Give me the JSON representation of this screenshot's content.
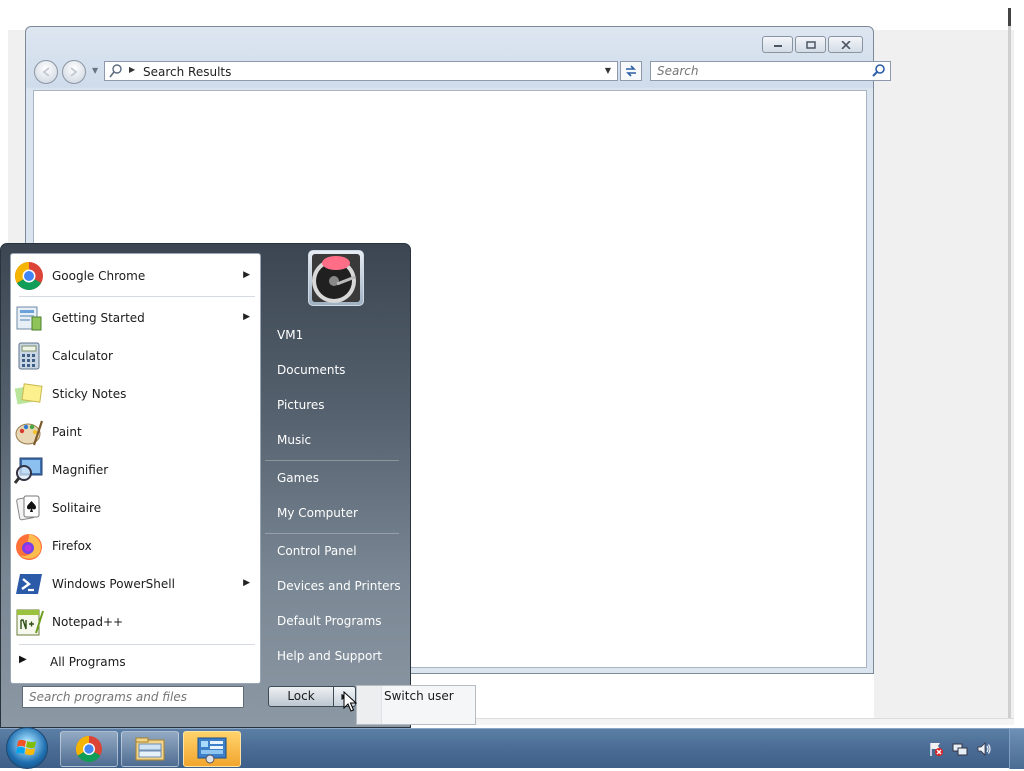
{
  "explorer": {
    "address": "Search Results",
    "search_placeholder": "Search",
    "window_buttons": [
      "minimize",
      "maximize",
      "close"
    ]
  },
  "start_menu": {
    "programs": [
      {
        "label": "Google Chrome",
        "icon": "chrome-icon",
        "submenu": true
      },
      {
        "label": "Getting Started",
        "icon": "getting-started-icon",
        "submenu": true
      },
      {
        "label": "Calculator",
        "icon": "calculator-icon",
        "submenu": false
      },
      {
        "label": "Sticky Notes",
        "icon": "sticky-notes-icon",
        "submenu": false
      },
      {
        "label": "Paint",
        "icon": "paint-icon",
        "submenu": false
      },
      {
        "label": "Magnifier",
        "icon": "magnifier-icon",
        "submenu": false
      },
      {
        "label": "Solitaire",
        "icon": "solitaire-icon",
        "submenu": false
      },
      {
        "label": "Firefox",
        "icon": "firefox-icon",
        "submenu": false
      },
      {
        "label": "Windows PowerShell",
        "icon": "powershell-icon",
        "submenu": true
      },
      {
        "label": "Notepad++",
        "icon": "notepadpp-icon",
        "submenu": false
      }
    ],
    "all_programs": "All Programs",
    "search_placeholder": "Search programs and files",
    "places": [
      {
        "label": "VM1"
      },
      {
        "label": "Documents"
      },
      {
        "label": "Pictures"
      },
      {
        "label": "Music"
      },
      {
        "label": "Games"
      },
      {
        "label": "My Computer"
      },
      {
        "label": "Control Panel"
      },
      {
        "label": "Devices and Printers"
      },
      {
        "label": "Default Programs"
      },
      {
        "label": "Help and Support"
      }
    ],
    "lock_label": "Lock",
    "flyout_item": "Switch user"
  },
  "taskbar": {
    "pinned": [
      "chrome-icon",
      "explorer-icon",
      "control-panel-icon"
    ],
    "active_item": "control-panel-icon",
    "tray": [
      "action-center-flag-icon",
      "network-icon",
      "volume-icon"
    ]
  },
  "colors": {
    "taskbar": "#4c6e96",
    "start_menu_right": "#55616e",
    "active_button": "#f2a52e"
  }
}
